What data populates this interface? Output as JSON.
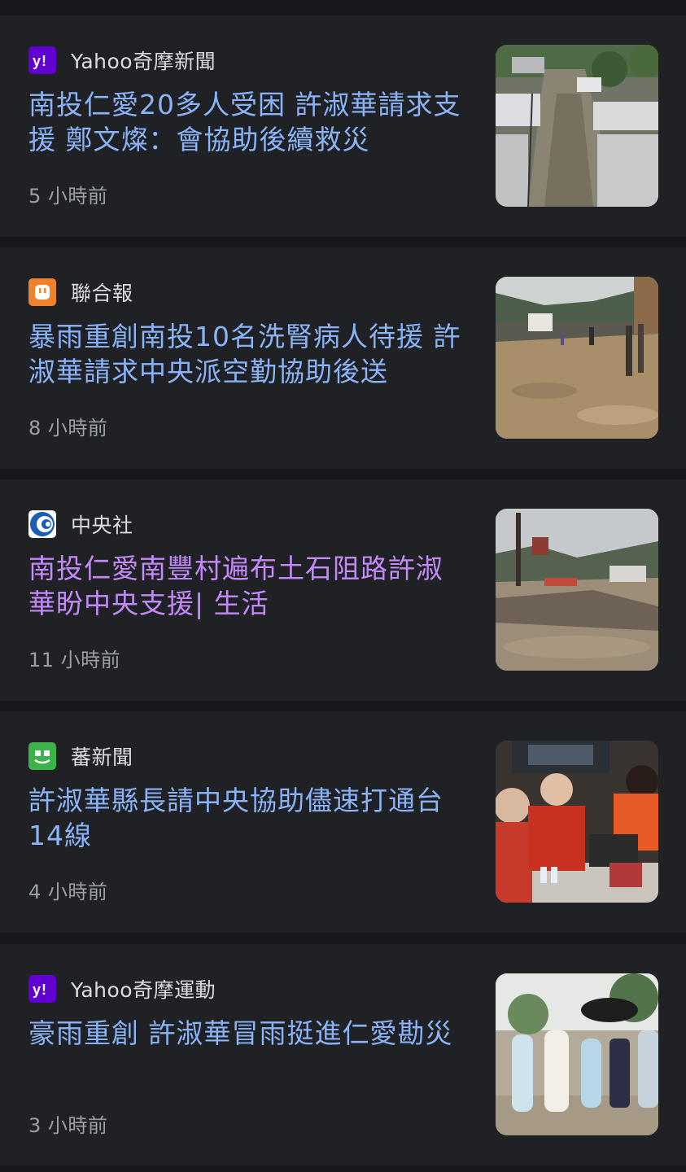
{
  "articles": [
    {
      "source": "Yahoo奇摩新聞",
      "source_icon": "yahoo-icon",
      "source_color": "#6001d2",
      "headline": "南投仁愛20多人受困 許淑華請求支援 鄭文燦：會協助後續救災",
      "time": "5 小時前",
      "visited": false,
      "thumbnail": "flooded-village-street-aerial"
    },
    {
      "source": "聯合報",
      "source_icon": "udn-icon",
      "source_color": "#f0822d",
      "headline": "暴雨重創南投10名洗腎病人待援 許淑華請求中央派空勤協助後送",
      "time": "8 小時前",
      "visited": false,
      "thumbnail": "people-walking-muddy-flood-road"
    },
    {
      "source": "中央社",
      "source_icon": "cna-icon",
      "source_color": "#1a5fb4",
      "headline": "南投仁愛南豐村遍布土石阻路許淑華盼中央支援| 生活",
      "time": "11 小時前",
      "visited": true,
      "thumbnail": "mudslide-covered-mountain-road"
    },
    {
      "source": "蕃新聞",
      "source_icon": "taronews-icon",
      "source_color": "#3cb34a",
      "headline": "許淑華縣長請中央協助儘速打通台14線",
      "time": "4 小時前",
      "visited": false,
      "thumbnail": "emergency-response-meeting"
    },
    {
      "source": "Yahoo奇摩運動",
      "source_icon": "yahoo-icon",
      "source_color": "#6001d2",
      "headline": "豪雨重創 許淑華冒雨挺進仁愛勘災",
      "time": "3 小時前",
      "visited": false,
      "thumbnail": "officials-in-raincoats-inspecting"
    }
  ],
  "colors": {
    "background": "#17181b",
    "card": "#202124",
    "link": "#8ab4f8",
    "visited_link": "#c58af9",
    "secondary_text": "#9aa0a6"
  }
}
